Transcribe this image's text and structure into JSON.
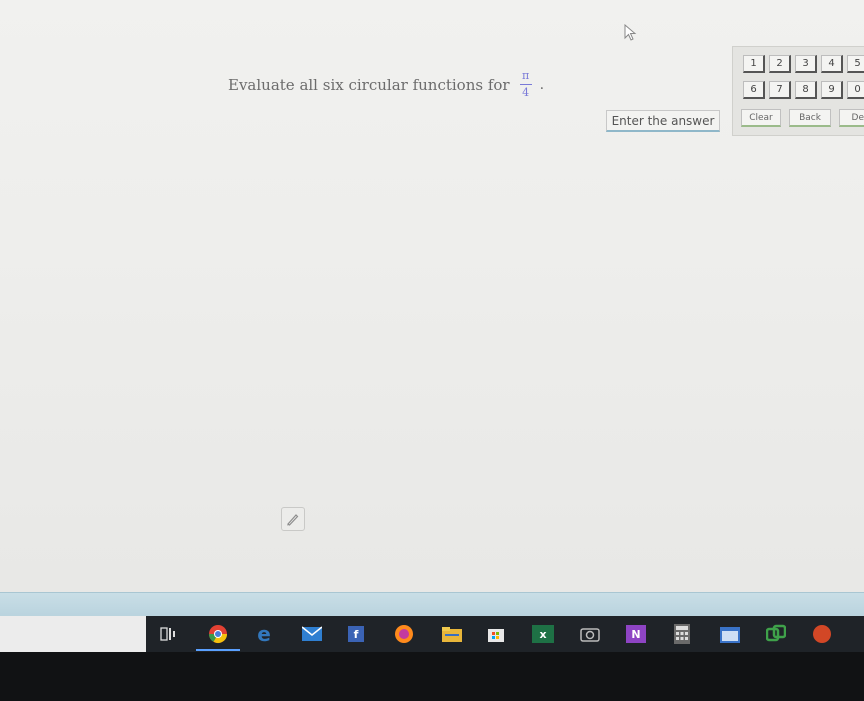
{
  "question": {
    "text": "Evaluate all six circular functions for",
    "numerator": "π",
    "denominator": "4",
    "period": "."
  },
  "enter_button": {
    "label": "Enter the answer"
  },
  "keypad": {
    "row1": [
      "1",
      "2",
      "3",
      "4",
      "5"
    ],
    "row2": [
      "6",
      "7",
      "8",
      "9",
      "0"
    ],
    "actions": [
      "Clear",
      "Back",
      "Del"
    ]
  },
  "taskbar": {
    "icons": [
      {
        "name": "task-view-icon",
        "color": "#dddddd"
      },
      {
        "name": "chrome-icon",
        "color": "#e34133"
      },
      {
        "name": "edge-icon",
        "color": "#3277bc"
      },
      {
        "name": "mail-icon",
        "color": "#2f7fd1"
      },
      {
        "name": "facebook-icon",
        "color": "#3b63b5"
      },
      {
        "name": "firefox-icon",
        "color": "#ff8a1c"
      },
      {
        "name": "file-explorer-icon",
        "color": "#e8b63a"
      },
      {
        "name": "store-icon",
        "color": "#e8e8e8"
      },
      {
        "name": "excel-icon",
        "color": "#1e7145"
      },
      {
        "name": "camera-icon",
        "color": "#8a8a8a"
      },
      {
        "name": "onenote-icon",
        "color": "#8e44c4"
      },
      {
        "name": "calculator-icon",
        "color": "#6a6a6a"
      },
      {
        "name": "calendar-icon",
        "color": "#3a73c8"
      },
      {
        "name": "link-app-icon",
        "color": "#3fa14a"
      },
      {
        "name": "powerpoint-icon",
        "color": "#d24726"
      }
    ]
  }
}
